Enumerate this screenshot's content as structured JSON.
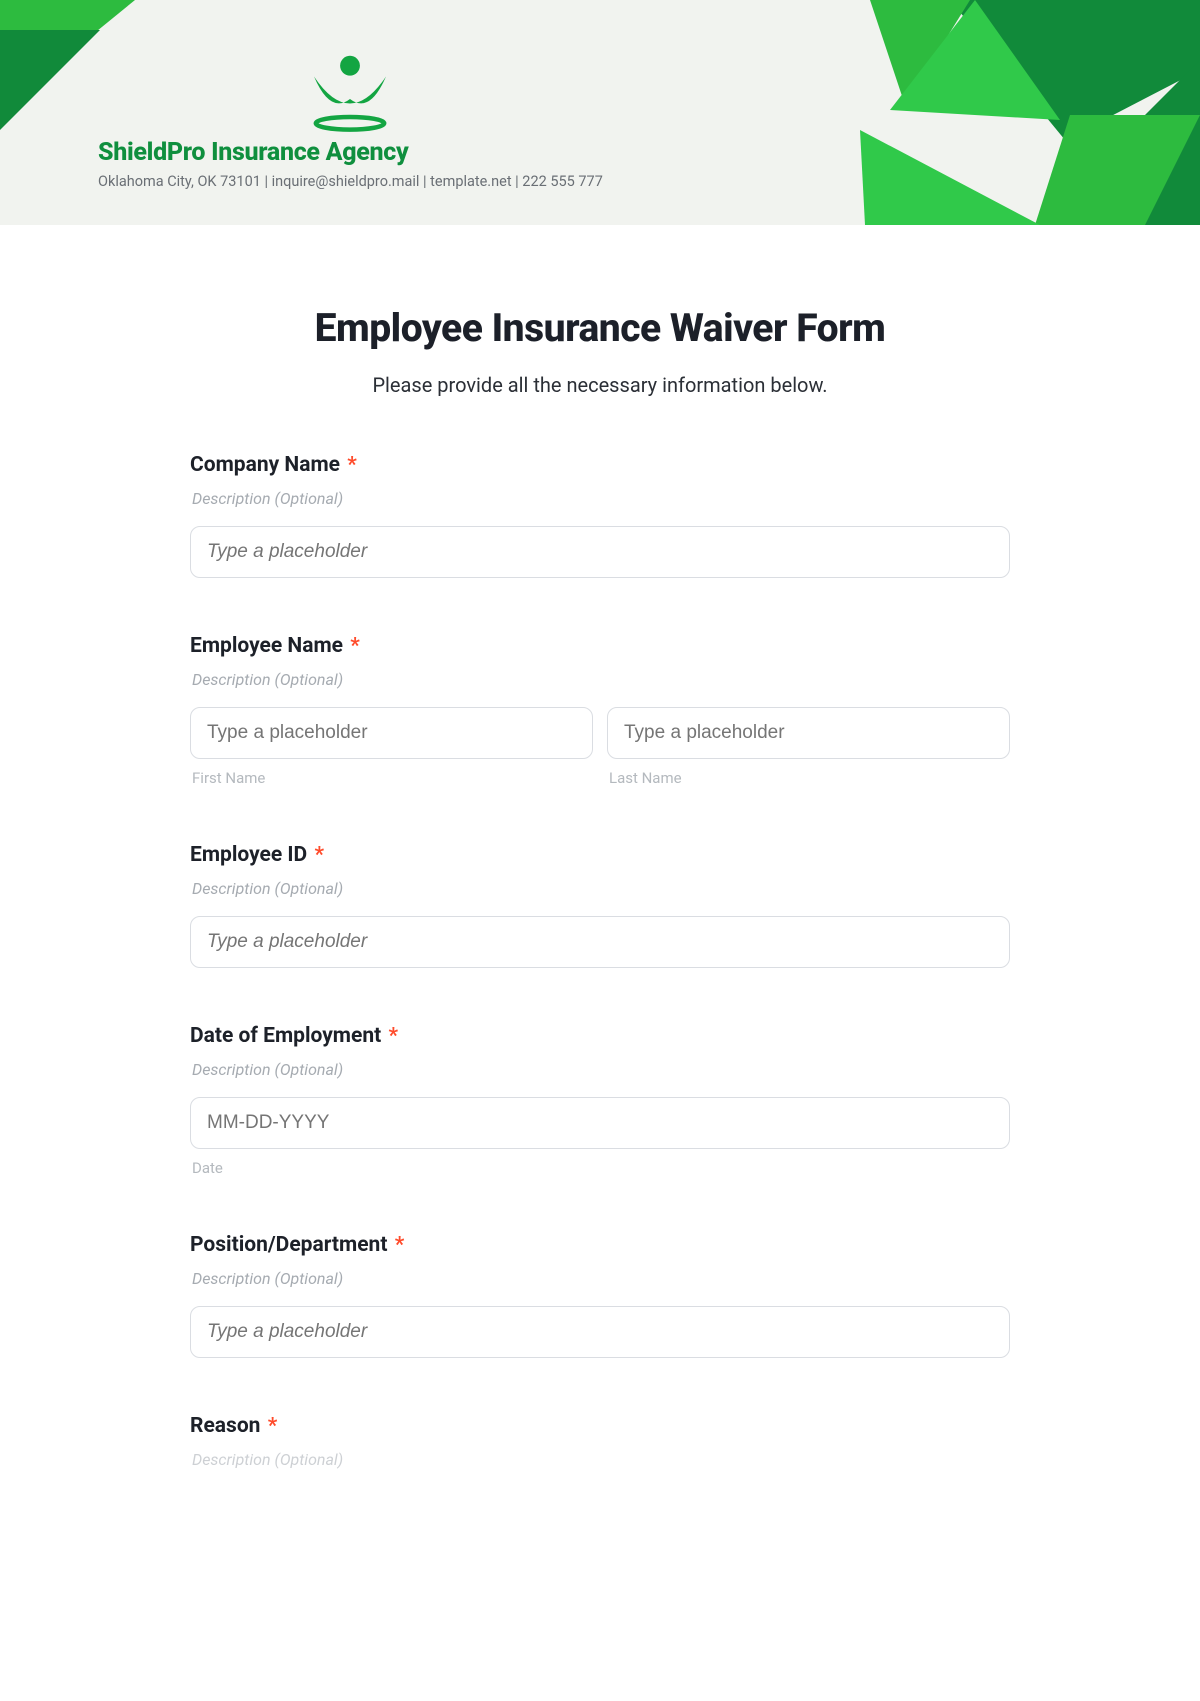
{
  "header": {
    "brand_name": "ShieldPro Insurance Agency",
    "brand_sub": "Oklahoma City, OK 73101 | inquire@shieldpro.mail | template.net | 222 555 777",
    "colors": {
      "brand_green": "#0f8f3e",
      "accent_green": "#2dbb3f",
      "dark_green": "#118a3a"
    }
  },
  "form": {
    "title": "Employee Insurance Waiver Form",
    "subtitle": "Please provide all the necessary information below.",
    "description_text": "Description (Optional)",
    "required_marker": "*",
    "placeholder_generic": "Type a placeholder",
    "fields": {
      "company_name": {
        "label": "Company Name"
      },
      "employee_name": {
        "label": "Employee Name",
        "first_sub": "First Name",
        "last_sub": "Last Name"
      },
      "employee_id": {
        "label": "Employee ID"
      },
      "date_of_employment": {
        "label": "Date of Employment",
        "placeholder": "MM-DD-YYYY",
        "sub": "Date"
      },
      "position_department": {
        "label": "Position/Department"
      },
      "reason": {
        "label": "Reason"
      }
    }
  }
}
